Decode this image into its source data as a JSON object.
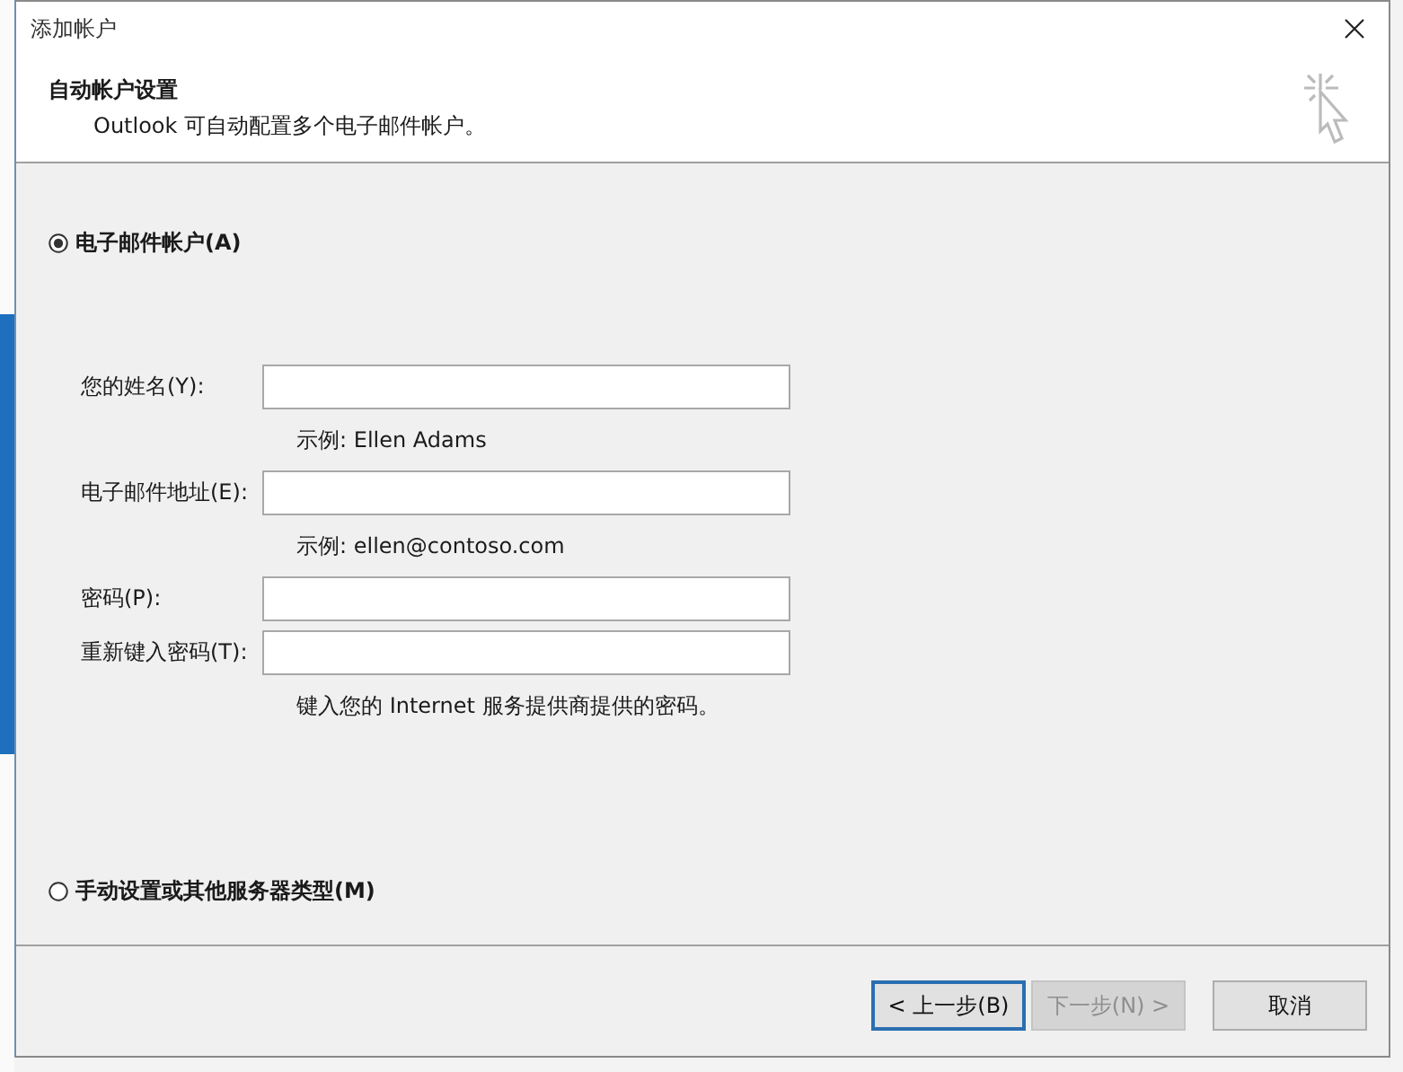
{
  "window": {
    "title": "添加帐户"
  },
  "header": {
    "title": "自动帐户设置",
    "subtitle": "Outlook 可自动配置多个电子邮件帐户。"
  },
  "options": [
    {
      "label": "电子邮件帐户(A)",
      "selected": true
    },
    {
      "label": "手动设置或其他服务器类型(M)",
      "selected": false
    }
  ],
  "fields": [
    {
      "label": "您的姓名(Y):",
      "hint": "示例: Ellen Adams"
    },
    {
      "label": "电子邮件地址(E):",
      "hint": "示例: ellen@contoso.com"
    },
    {
      "label": "密码(P):"
    },
    {
      "label": "重新键入密码(T):",
      "hint": "键入您的 Internet 服务提供商提供的密码。"
    }
  ],
  "buttons": [
    {
      "label": "< 上一步(B)",
      "disabled": false,
      "focused": true
    },
    {
      "label": "下一步(N) >",
      "disabled": true,
      "focused": false
    },
    {
      "label": "取消",
      "disabled": false,
      "focused": false
    }
  ]
}
